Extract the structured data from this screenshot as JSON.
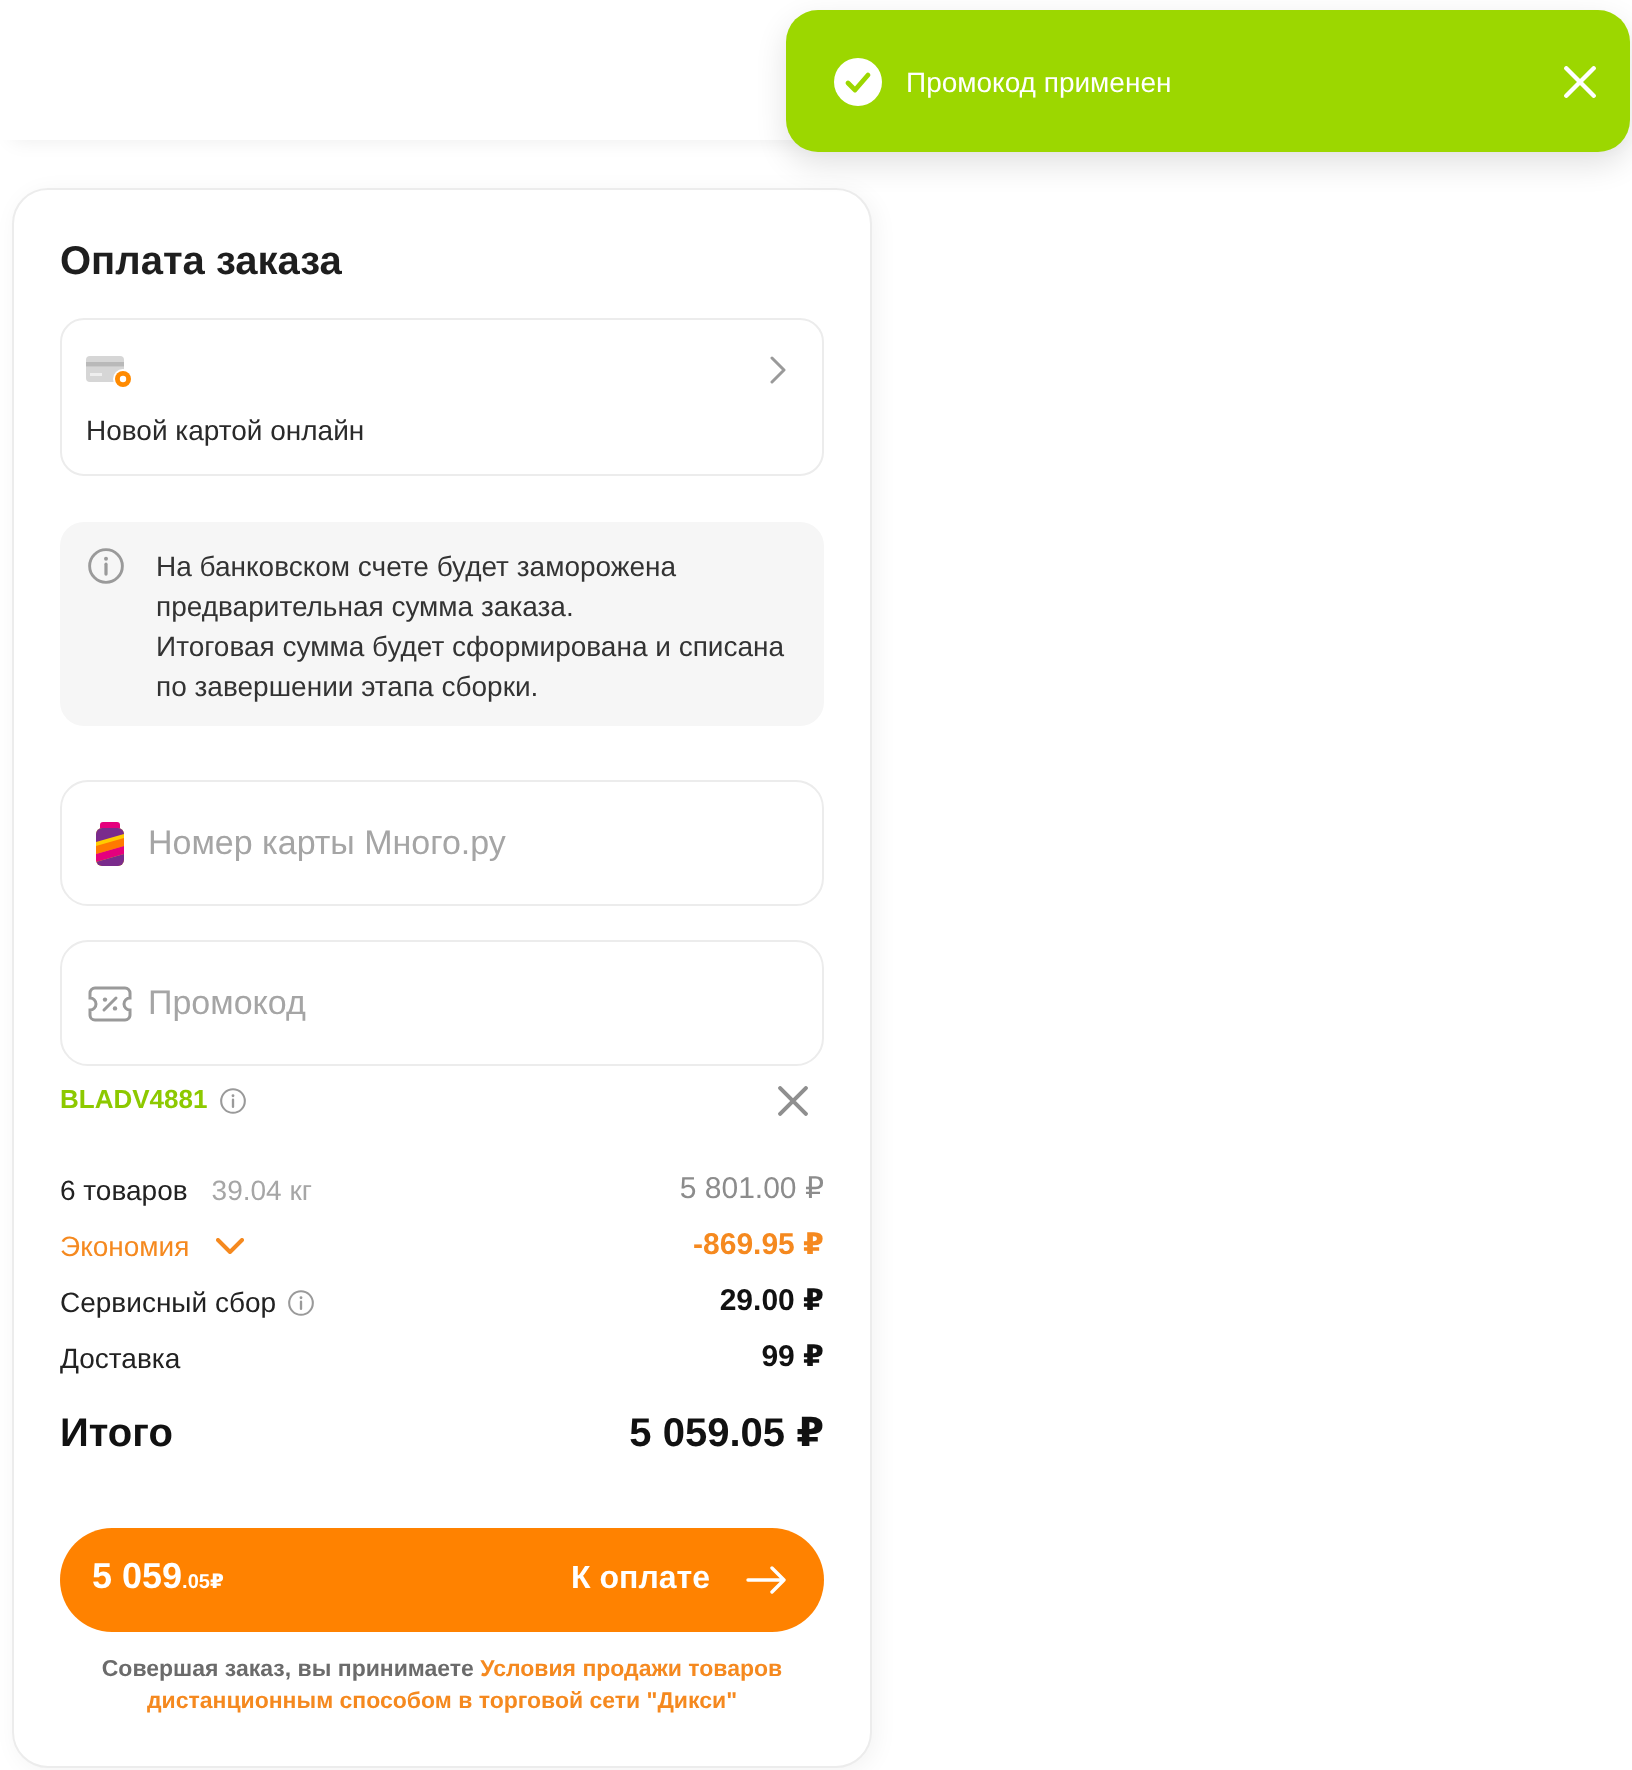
{
  "toast": {
    "kind": "success",
    "message": "Промокод применен"
  },
  "payment": {
    "title": "Оплата заказа",
    "method": {
      "label": "Новой картой онлайн"
    },
    "notice": [
      "На банковском счете будет заморожена предварительная сумма заказа.",
      "Итоговая сумма будет сформирована и списана по завершении этапа сборки."
    ]
  },
  "loyalty_field": {
    "placeholder": "Номер карты Много.ру"
  },
  "promo_field": {
    "placeholder": "Промокод"
  },
  "applied_promo": {
    "code": "BLADV4881"
  },
  "summary": [
    {
      "kind": "items",
      "label": "6 товаров",
      "note": "39.04 кг",
      "value": "5 801.00 ₽"
    },
    {
      "kind": "discount",
      "label": "Экономия",
      "value": "-869.95 ₽",
      "expanded": false
    },
    {
      "kind": "fee",
      "label": "Сервисный сбор",
      "value": "29.00 ₽"
    },
    {
      "kind": "plain",
      "label": "Доставка",
      "value": "99 ₽"
    }
  ],
  "total": {
    "label": "Итого",
    "value": "5 059.05 ₽"
  },
  "pay_button": {
    "amount": "5 059",
    "cents": ".05₽",
    "label": "К оплате"
  },
  "terms": {
    "text": "Совершая заказ, вы принимаете",
    "link": [
      "Условия продажи товаров",
      "дистанционным способом в торговой сети \"Дикси\""
    ]
  }
}
